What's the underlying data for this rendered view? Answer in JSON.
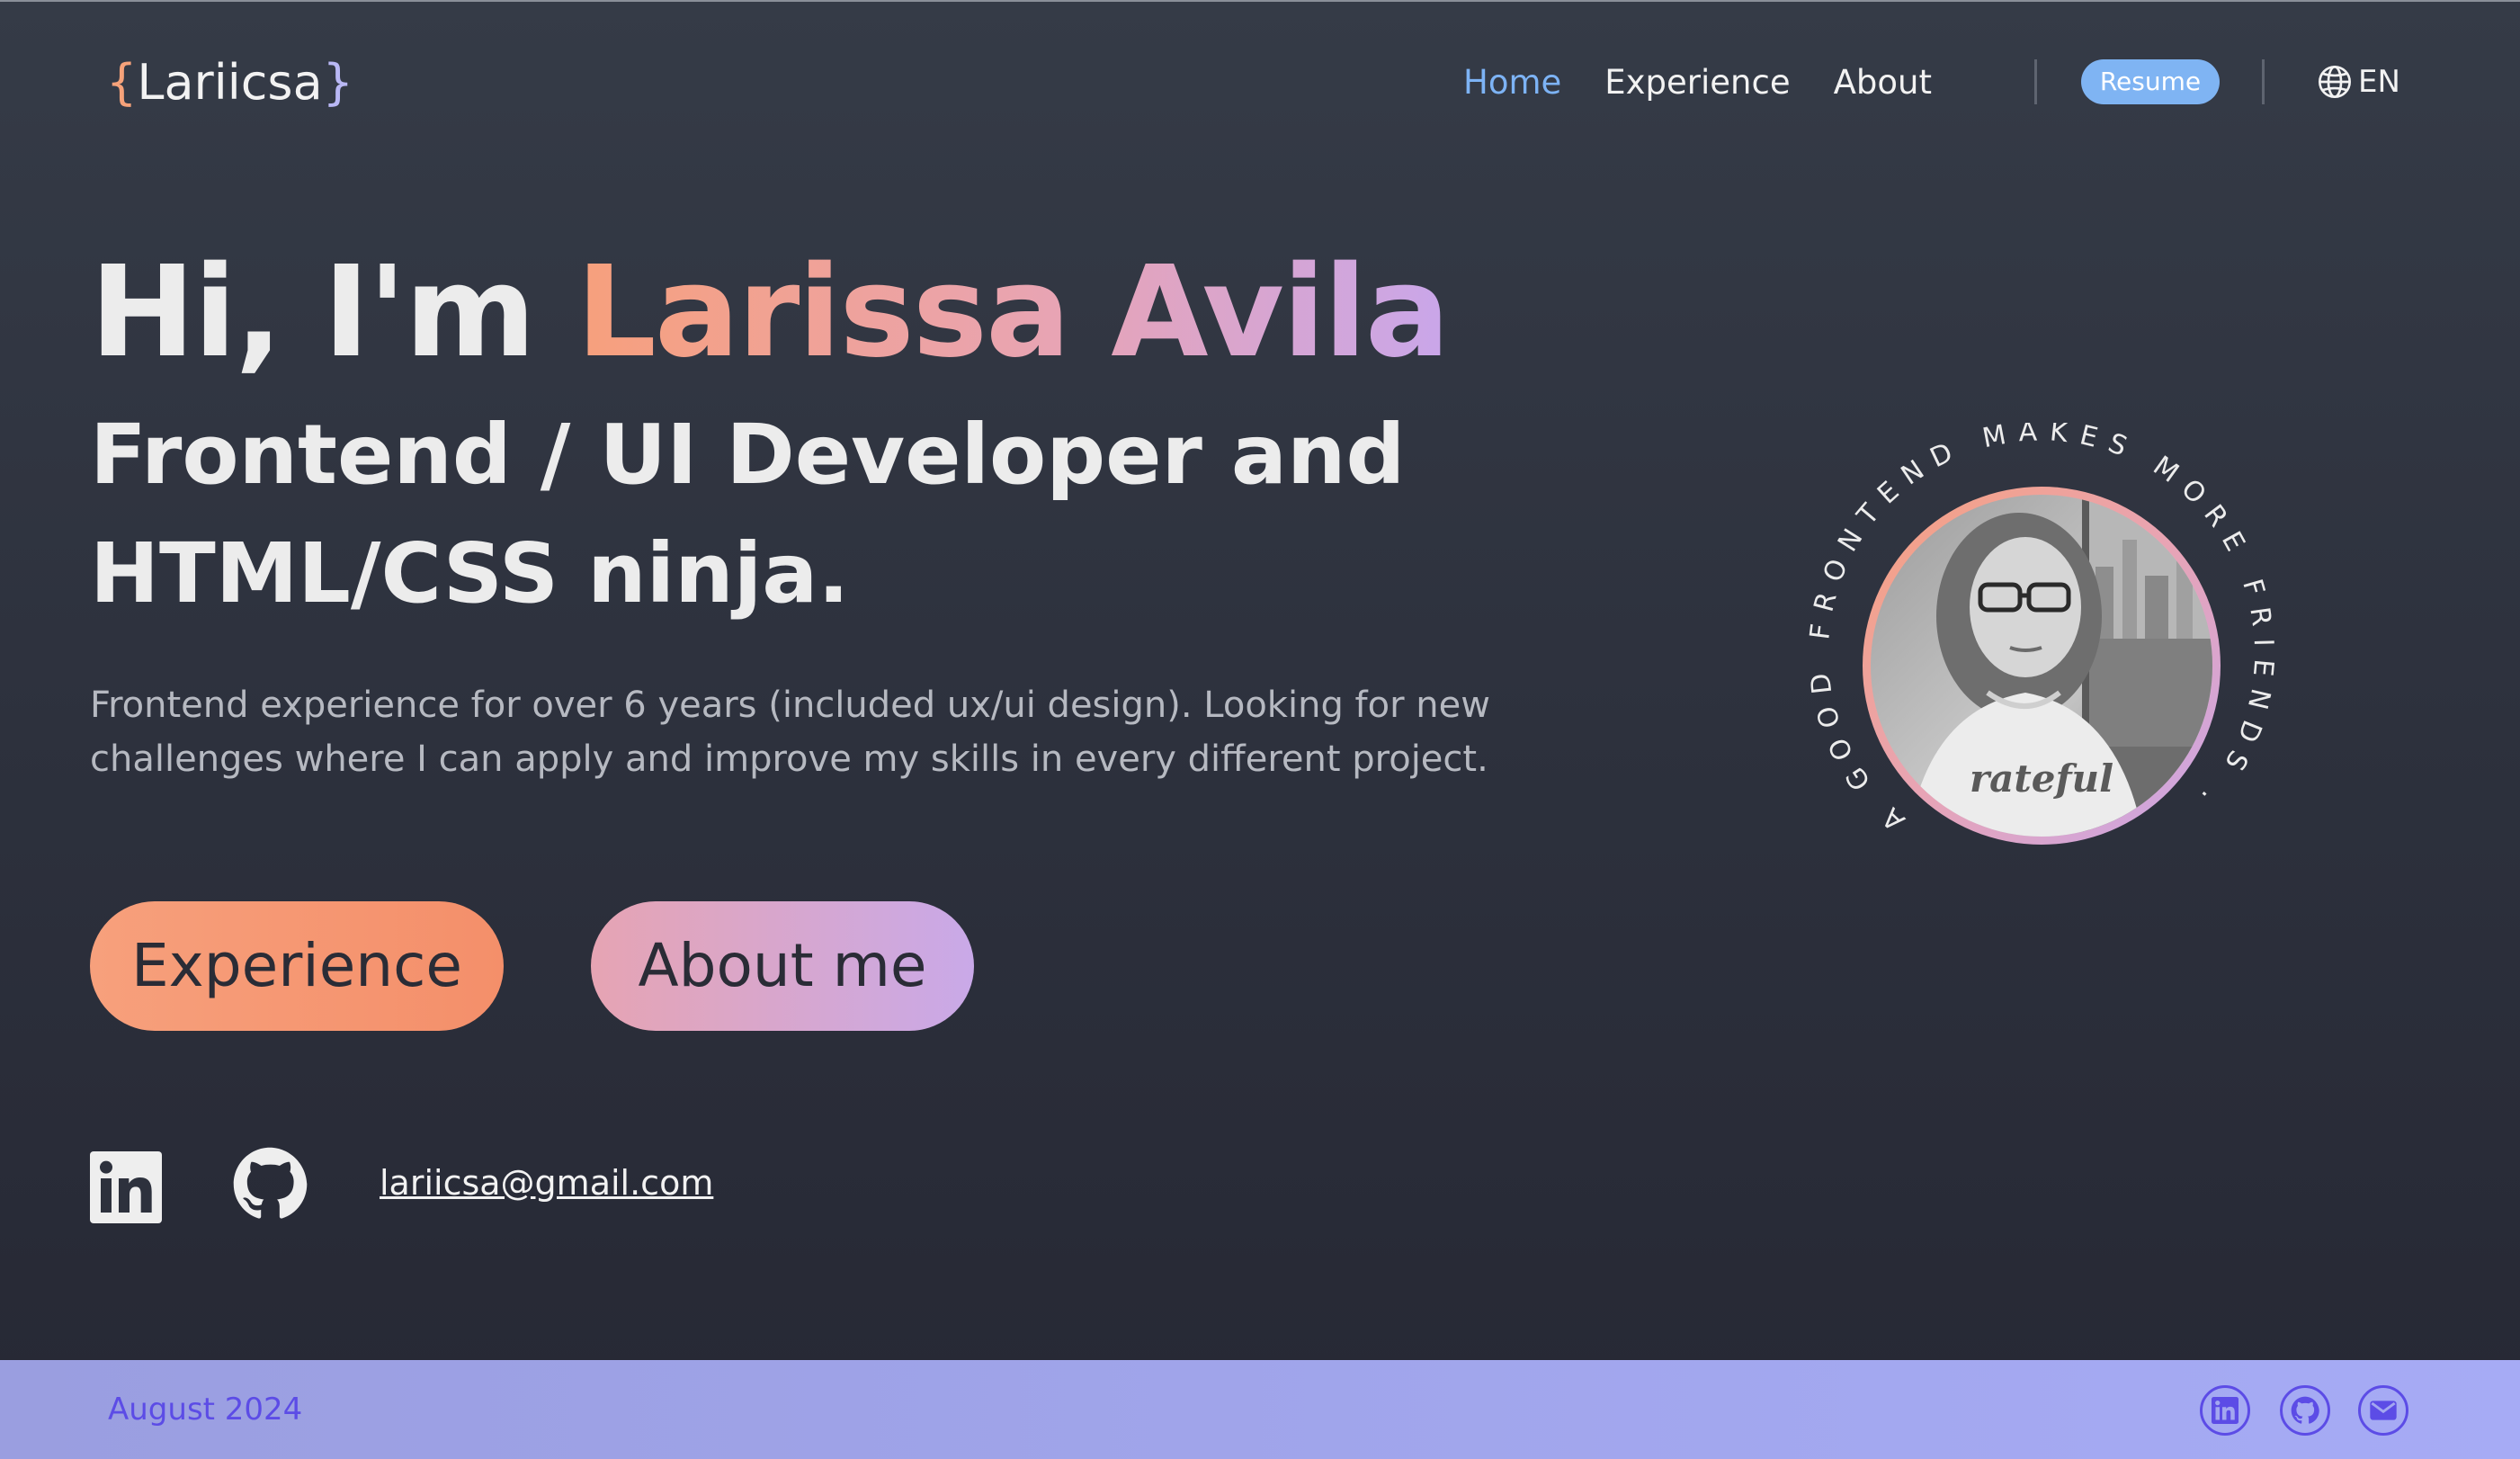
{
  "logo": {
    "brace_open": "{",
    "name": "Lariicsa",
    "brace_close": "}"
  },
  "nav": {
    "items": [
      {
        "label": "Home",
        "active": true
      },
      {
        "label": "Experience",
        "active": false
      },
      {
        "label": "About",
        "active": false
      }
    ],
    "resume_label": "Resume",
    "language_label": "EN",
    "language_icon": "globe-icon"
  },
  "hero": {
    "greeting": "Hi, I'm ",
    "name": "Larissa Avila",
    "subtitle": "Frontend / UI Developer and HTML/CSS ninja.",
    "description": "Frontend experience for over 6 years (included ux/ui design). Looking for new challenges where I can apply and improve my skills in every different project.",
    "buttons": {
      "experience": "Experience",
      "about": "About me"
    }
  },
  "social": {
    "linkedin_icon": "linkedin-icon",
    "github_icon": "github-icon",
    "email": "lariicsa@gmail.com"
  },
  "portrait": {
    "circular_text": "A GOOD FRONTEND MAKES MORE FRIENDS ."
  },
  "footer": {
    "date": "August 2024",
    "icons": [
      "linkedin-icon",
      "github-icon",
      "mail-icon"
    ]
  },
  "colors": {
    "accent_blue": "#7fb4f3",
    "gradient_orange": "#f7a07c",
    "gradient_purple": "#c9a6ea",
    "footer_bg": "#a6abf5",
    "footer_text": "#5c4ce6"
  }
}
